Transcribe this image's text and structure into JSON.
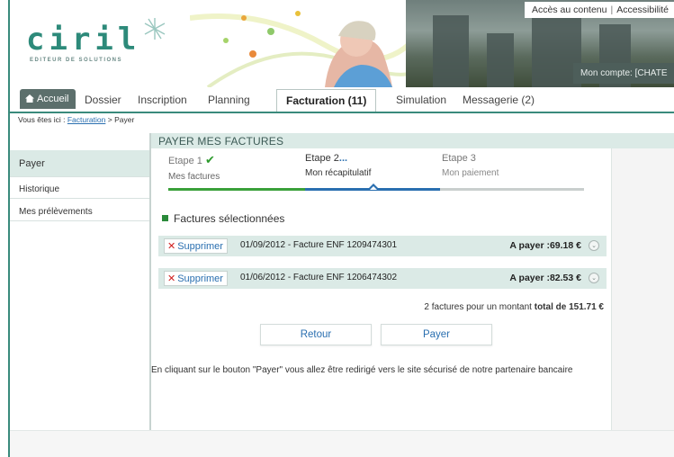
{
  "brand": {
    "logo_text": "ciril",
    "tagline": "EDITEUR DE SOLUTIONS"
  },
  "header": {
    "access_content": "Accès au contenu",
    "separator": "|",
    "accessibility": "Accessibilité",
    "account": "Mon compte: [CHATE"
  },
  "nav": {
    "home": "Accueil",
    "items": [
      "Dossier",
      "Inscription",
      "Planning",
      "Facturation (11)",
      "Simulation",
      "Messagerie (2)"
    ]
  },
  "breadcrumb": {
    "prefix": "Vous êtes ici :",
    "link": "Facturation",
    "sep": ">",
    "current": "Payer"
  },
  "sidebar": {
    "items": [
      "Payer",
      "Historique",
      "Mes prélèvements"
    ]
  },
  "page": {
    "title": "PAYER MES FACTURES"
  },
  "steps": [
    {
      "label": "Etape 1",
      "sub": "Mes factures"
    },
    {
      "label": "Etape 2",
      "sub": "Mon récapitulatif"
    },
    {
      "label": "Etape 3",
      "sub": "Mon paiement"
    }
  ],
  "section": {
    "title": "Factures sélectionnées"
  },
  "invoices": [
    {
      "delete": "Supprimer",
      "label": "01/09/2012 - Facture ENF 1209474301",
      "amount": "A payer :69.18 €"
    },
    {
      "delete": "Supprimer",
      "label": "01/06/2012 - Facture ENF 1206474302",
      "amount": "A payer :82.53 €"
    }
  ],
  "summary": {
    "text": "2 factures pour un montant",
    "total": "total de 151.71 €"
  },
  "buttons": {
    "back": "Retour",
    "pay": "Payer"
  },
  "notice": "En cliquant sur le bouton \"Payer\" vous allez être redirigé vers le site sécurisé de notre partenaire bancaire",
  "colors": {
    "brand_teal": "#2d8a7a",
    "accent_light": "#dbeae6",
    "link_blue": "#2a6fb0",
    "success_green": "#3aa03a",
    "delete_red": "#d02020"
  },
  "icons": {
    "home": "house-icon",
    "check": "checkmark-icon",
    "delete": "x-icon",
    "expand": "chevron-down-circle-icon",
    "bullet": "square-bullet-icon"
  }
}
